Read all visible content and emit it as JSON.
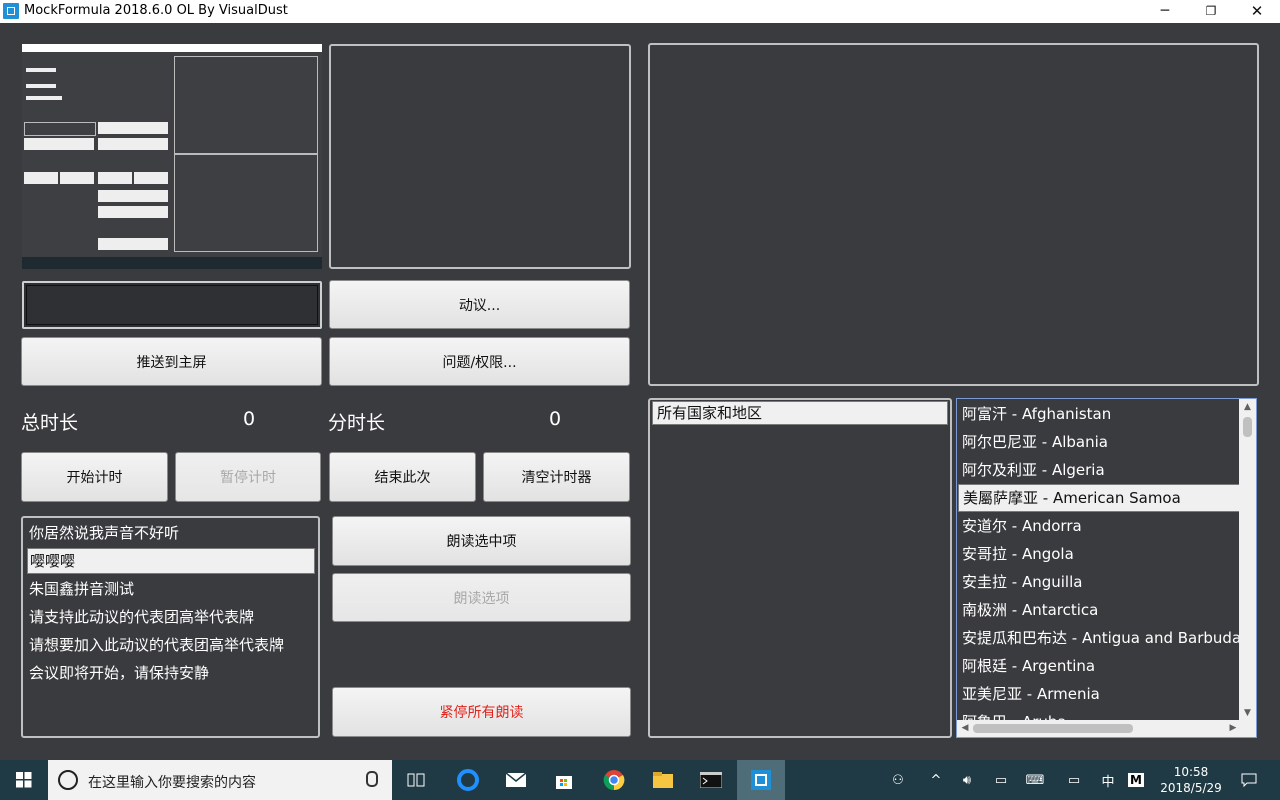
{
  "window": {
    "title": "MockFormula 2018.6.0 OL By VisualDust",
    "min": "─",
    "max": "❐",
    "close": "✕"
  },
  "buttons": {
    "motion": "动议...",
    "push_main": "推送到主屏",
    "question": "问题/权限...",
    "start_timer": "开始计时",
    "pause_timer": "暂停计时",
    "end_this": "结束此次",
    "clear_timer": "清空计时器",
    "read_selected": "朗读选中项",
    "read_option": "朗读选项",
    "stop_all_reading": "紧停所有朗读"
  },
  "timers": {
    "total_label": "总时长",
    "total_value": "0",
    "segment_label": "分时长",
    "segment_value": "0"
  },
  "speech_list": [
    "你居然说我声音不好听",
    "嘤嘤嘤",
    "朱国鑫拼音测试",
    "请支持此动议的代表团高举代表牌",
    "请想要加入此动议的代表团高举代表牌",
    "会议即将开始，请保持安静"
  ],
  "speech_selected_index": 1,
  "region_filter": "所有国家和地区",
  "countries": [
    "阿富汗 - Afghanistan",
    "阿尔巴尼亚 - Albania",
    "阿尔及利亚 - Algeria",
    "美屬萨摩亚 - American Samoa",
    "安道尔 - Andorra",
    "安哥拉 - Angola",
    "安圭拉 - Anguilla",
    "南极洲 - Antarctica",
    "安提瓜和巴布达 - Antigua and Barbuda",
    "阿根廷 - Argentina",
    "亚美尼亚 - Armenia",
    "阿鲁巴 - Aruba"
  ],
  "countries_selected_index": 3,
  "taskbar": {
    "search_placeholder": "在这里输入你要搜索的内容",
    "time": "10:58",
    "date": "2018/5/29",
    "ime": "中",
    "ime_mode": "M"
  },
  "colors": {
    "background": "#3a3b3e",
    "danger": "#e0241b",
    "taskbar": "#1f3a44"
  }
}
